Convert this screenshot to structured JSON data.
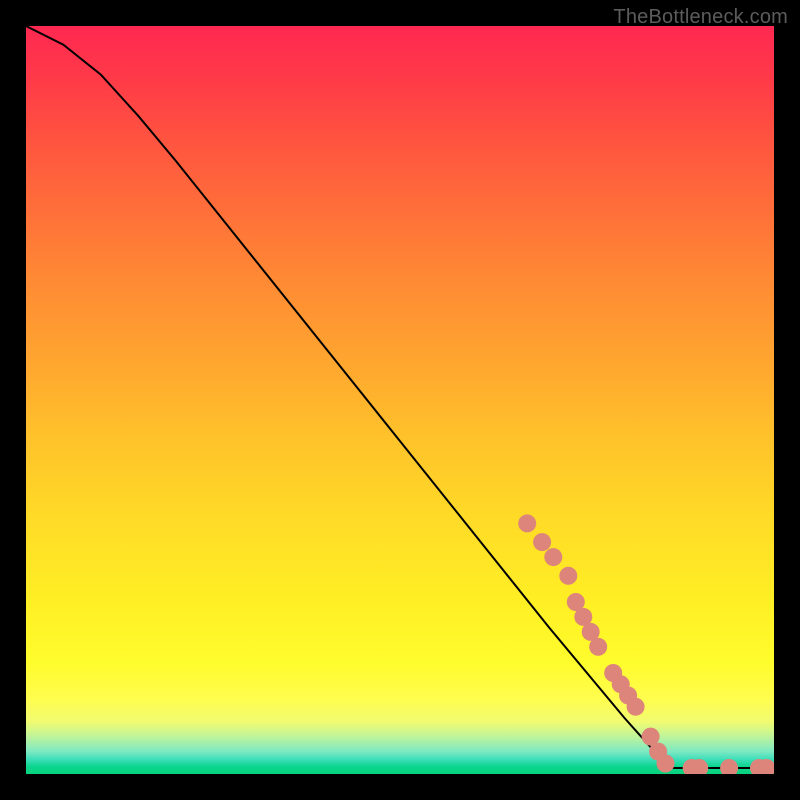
{
  "watermark": "TheBottleneck.com",
  "chart_data": {
    "type": "line",
    "title": "",
    "xlabel": "",
    "ylabel": "",
    "xlim": [
      0,
      100
    ],
    "ylim": [
      0,
      100
    ],
    "curve": [
      {
        "x": 0.0,
        "y": 100.0
      },
      {
        "x": 5.0,
        "y": 97.5
      },
      {
        "x": 10.0,
        "y": 93.5
      },
      {
        "x": 15.0,
        "y": 88.0
      },
      {
        "x": 20.0,
        "y": 82.0
      },
      {
        "x": 30.0,
        "y": 69.5
      },
      {
        "x": 40.0,
        "y": 57.0
      },
      {
        "x": 50.0,
        "y": 44.5
      },
      {
        "x": 60.0,
        "y": 32.0
      },
      {
        "x": 70.0,
        "y": 19.5
      },
      {
        "x": 80.0,
        "y": 7.5
      },
      {
        "x": 86.0,
        "y": 0.8
      },
      {
        "x": 90.0,
        "y": 0.8
      },
      {
        "x": 95.0,
        "y": 0.8
      },
      {
        "x": 100.0,
        "y": 0.8
      }
    ],
    "markers": [
      {
        "x": 67.0,
        "y": 33.5
      },
      {
        "x": 69.0,
        "y": 31.0
      },
      {
        "x": 70.5,
        "y": 29.0
      },
      {
        "x": 72.5,
        "y": 26.5
      },
      {
        "x": 73.5,
        "y": 23.0
      },
      {
        "x": 74.5,
        "y": 21.0
      },
      {
        "x": 75.5,
        "y": 19.0
      },
      {
        "x": 76.5,
        "y": 17.0
      },
      {
        "x": 78.5,
        "y": 13.5
      },
      {
        "x": 79.5,
        "y": 12.0
      },
      {
        "x": 80.5,
        "y": 10.5
      },
      {
        "x": 81.5,
        "y": 9.0
      },
      {
        "x": 83.5,
        "y": 5.0
      },
      {
        "x": 84.5,
        "y": 3.0
      },
      {
        "x": 85.5,
        "y": 1.4
      },
      {
        "x": 89.0,
        "y": 0.8
      },
      {
        "x": 90.0,
        "y": 0.8
      },
      {
        "x": 94.0,
        "y": 0.8
      },
      {
        "x": 98.0,
        "y": 0.8
      },
      {
        "x": 99.0,
        "y": 0.8
      }
    ],
    "marker_color": "#dd847b",
    "marker_radius_px": 9,
    "line_color": "#000000"
  }
}
